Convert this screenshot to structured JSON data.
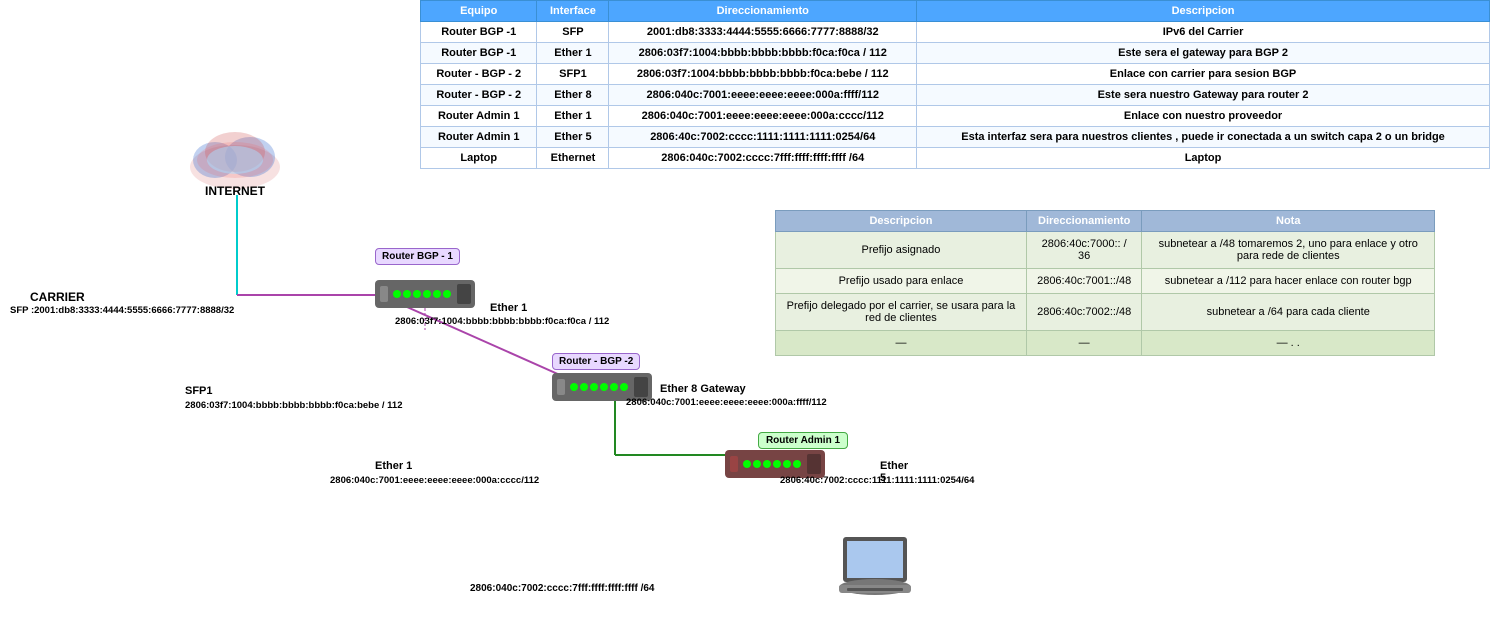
{
  "table": {
    "headers": [
      "Equipo",
      "Interface",
      "Direccionamiento",
      "Descripcion"
    ],
    "rows": [
      {
        "equipo": "Router BGP -1",
        "interface": "SFP",
        "direccionamiento": "2001:db8:3333:4444:5555:6666:7777:8888/32",
        "descripcion": "IPv6 del Carrier"
      },
      {
        "equipo": "Router BGP -1",
        "interface": "Ether 1",
        "direccionamiento": "2806:03f7:1004:bbbb:bbbb:bbbb:f0ca:f0ca / 112",
        "descripcion": "Este sera el gateway para BGP 2"
      },
      {
        "equipo": "Router - BGP - 2",
        "interface": "SFP1",
        "direccionamiento": "2806:03f7:1004:bbbb:bbbb:bbbb:f0ca:bebe / 112",
        "descripcion": "Enlace con carrier para sesion BGP"
      },
      {
        "equipo": "Router - BGP - 2",
        "interface": "Ether 8",
        "direccionamiento": "2806:040c:7001:eeee:eeee:eeee:000a:ffff/112",
        "descripcion": "Este sera nuestro Gateway para router 2"
      },
      {
        "equipo": "Router Admin 1",
        "interface": "Ether 1",
        "direccionamiento": "2806:040c:7001:eeee:eeee:eeee:000a:cccc/112",
        "descripcion": "Enlace con nuestro proveedor"
      },
      {
        "equipo": "Router Admin 1",
        "interface": "Ether 5",
        "direccionamiento": "2806:40c:7002:cccc:1111:1111:1111:0254/64",
        "descripcion": "Esta interfaz sera para nuestros clientes , puede ir conectada a un switch capa 2 o un bridge"
      },
      {
        "equipo": "Laptop",
        "interface": "Ethernet",
        "direccionamiento": "2806:040c:7002:cccc:7fff:ffff:ffff:ffff /64",
        "descripcion": "Laptop"
      }
    ]
  },
  "second_table": {
    "headers": [
      "Descripcion",
      "Direccionamiento",
      "Nota"
    ],
    "rows": [
      {
        "descripcion": "Prefijo asignado",
        "direccionamiento": "2806:40c:7000:: / 36",
        "nota": "subnetear a /48  tomaremos 2, uno para enlace y otro para rede de clientes"
      },
      {
        "descripcion": "Prefijo usado para enlace",
        "direccionamiento": "2806:40c:7001::/48",
        "nota": "subnetear a /112 para hacer enlace con router bgp"
      },
      {
        "descripcion": "Prefijo delegado por el carrier, se usara para la red de clientes",
        "direccionamiento": "2806:40c:7002::/48",
        "nota": "subnetear a /64 para cada cliente"
      },
      {
        "descripcion": "—",
        "direccionamiento": "—",
        "nota": "— . ."
      }
    ]
  },
  "diagram": {
    "internet_label": "INTERNET",
    "carrier_label": "CARRIER",
    "carrier_addr": "SFP :2001:db8:3333:4444:5555:6666:7777:8888/32",
    "router_bgp1_label": "Router BGP -\n1",
    "router_bgp2_label": "Router - BGP -2",
    "router_admin1_label": "Router Admin 1",
    "ether1_label": "Ether 1",
    "ether1_addr": "2806:03f7:1004:bbbb:bbbb:bbbb:f0ca:f0ca / 112",
    "sfp1_label": "SFP1",
    "sfp1_addr": "2806:03f7:1004:bbbb:bbbb:bbbb:f0ca:bebe / 112",
    "ether8_label": "Ether 8 Gateway",
    "ether8_addr": "2806:040c:7001:eeee:eeee:eeee:000a:ffff/112",
    "ether1_admin_label": "Ether 1",
    "ether1_admin_addr": "2806:040c:7001:eeee:eeee:eeee:000a:cccc/112",
    "ether5_label": "Ether 5",
    "ether5_addr": "2806:40c:7002:cccc:1111:1111:1111:0254/64",
    "laptop_addr": "2806:040c:7002:cccc:7fff:ffff:ffff:ffff /64"
  }
}
